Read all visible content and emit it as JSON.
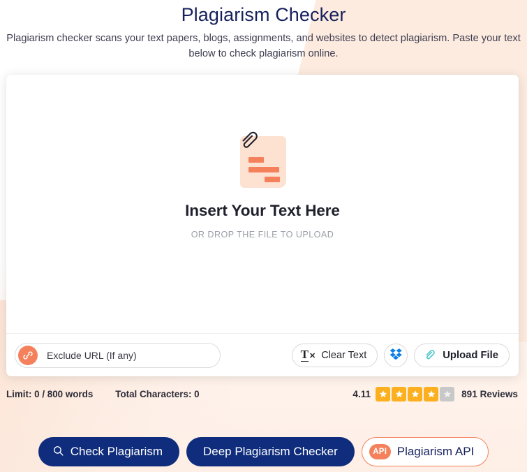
{
  "header": {
    "title": "Plagiarism Checker",
    "subtitle": "Plagiarism checker scans your text papers, blogs, assignments, and websites to detect plagiarism. Paste your text below to check plagiarism online."
  },
  "editor": {
    "dropzone_title": "Insert Your Text Here",
    "dropzone_subtitle": "OR DROP THE FILE TO UPLOAD",
    "doc_icon_name": "document-with-paperclip-icon"
  },
  "toolbar": {
    "exclude_url_placeholder": "Exclude URL (If any)",
    "exclude_url_value": "",
    "link_icon_name": "link-icon",
    "clear_text_label": "Clear Text",
    "clear_text_icon_name": "clear-text-icon",
    "dropbox_icon_name": "dropbox-icon",
    "upload_file_label": "Upload File",
    "upload_file_icon_name": "paperclip-icon"
  },
  "stats": {
    "word_limit": "Limit: 0 / 800 words",
    "total_characters": "Total Characters: 0"
  },
  "rating": {
    "score": "4.11",
    "reviews": "891 Reviews",
    "stars_filled": 4,
    "stars_total": 5
  },
  "actions": {
    "check_plagiarism": "Check Plagiarism",
    "search_icon_name": "search-icon",
    "deep_plagiarism_checker": "Deep Plagiarism Checker",
    "plagiarism_api": "Plagiarism API",
    "api_badge": "API"
  },
  "colors": {
    "brand_navy": "#0f2d7c",
    "title_navy": "#16215b",
    "accent_orange": "#f4815b",
    "peach_bg": "#fdeade",
    "star_gold": "#fcb01f",
    "star_gray": "#c8c8c8",
    "dropbox_blue": "#0c7ee8",
    "paperclip_teal": "#4bc4c9"
  }
}
